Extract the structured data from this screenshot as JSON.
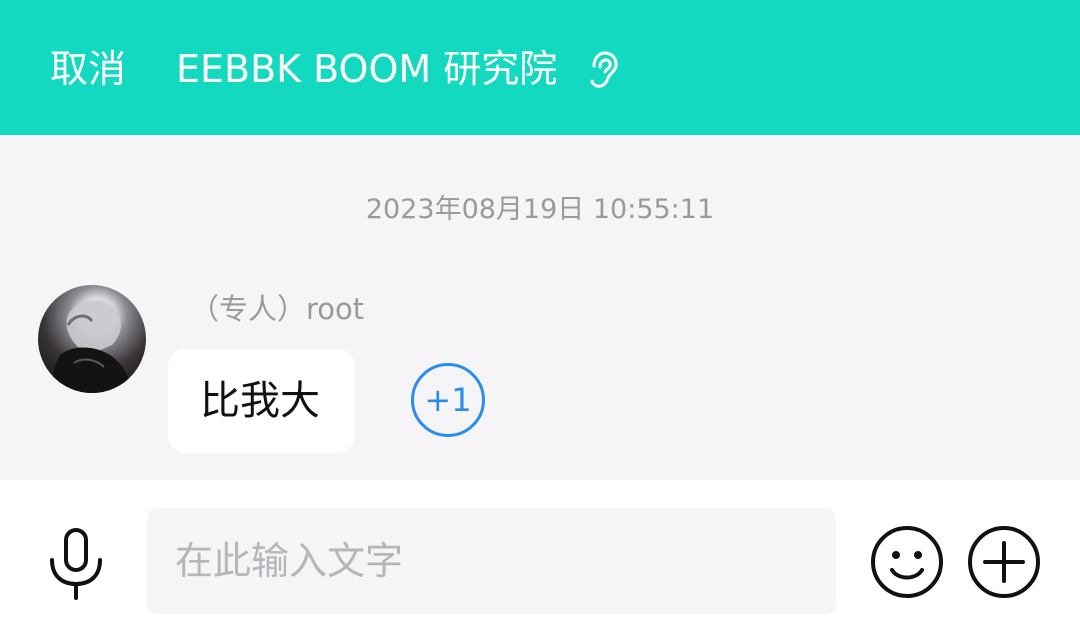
{
  "header": {
    "cancel_label": "取消",
    "title": "EEBBK BOOM 研究院",
    "ear_icon": "ear-icon",
    "background_color": "#12d9c0"
  },
  "chat": {
    "timestamp": "2023年08月19日 10:55:11",
    "messages": [
      {
        "sender": "（专人）root",
        "text": "比我大",
        "reaction_label": "+1"
      }
    ]
  },
  "input_bar": {
    "placeholder": "在此输入文字",
    "value": "",
    "voice_icon": "microphone-icon",
    "emoji_icon": "smiley-icon",
    "more_icon": "plus-circle-icon"
  },
  "colors": {
    "accent": "#12d9c0",
    "reaction_blue": "#2a8cf0"
  }
}
